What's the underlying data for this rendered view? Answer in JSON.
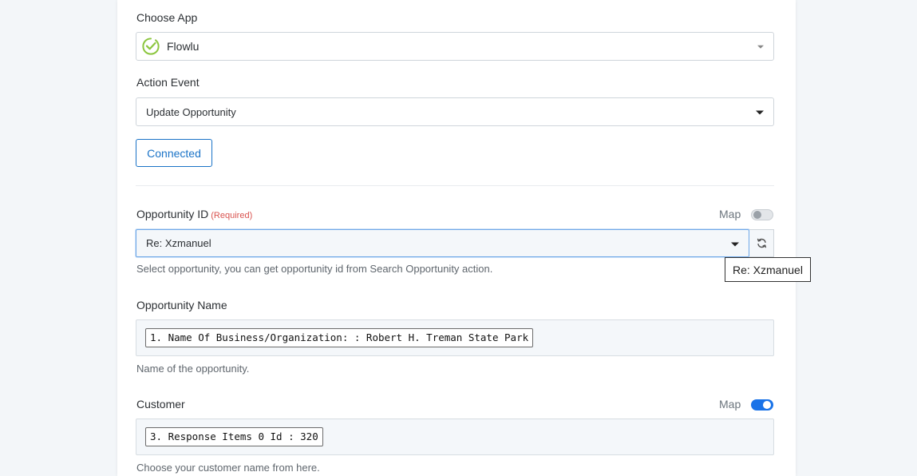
{
  "choose_app": {
    "label": "Choose App",
    "value": "Flowlu",
    "logo_icon": "flowlu-check-leaf-icon",
    "logo_color": "#8cc63f"
  },
  "action_event": {
    "label": "Action Event",
    "value": "Update Opportunity"
  },
  "connected_button": {
    "label": "Connected",
    "color": "#1a73c7"
  },
  "opportunity_id": {
    "label": "Opportunity ID",
    "required": "(Required)",
    "map_label": "Map",
    "map_enabled": false,
    "value": "Re: Xzmanuel",
    "help": "Select opportunity, you can get opportunity id from Search Opportunity action.",
    "tooltip": "Re: Xzmanuel"
  },
  "opportunity_name": {
    "label": "Opportunity Name",
    "chip": "1. Name Of Business/Organization: : Robert H. Treman State Park",
    "help": "Name of the opportunity."
  },
  "customer": {
    "label": "Customer",
    "map_label": "Map",
    "map_enabled": true,
    "chip": "3. Response Items 0 Id : 320",
    "help": "Choose your customer name from here."
  },
  "colors": {
    "accent": "#1a73e8",
    "required": "#d9534f",
    "page_background": "#f3f6f9"
  }
}
